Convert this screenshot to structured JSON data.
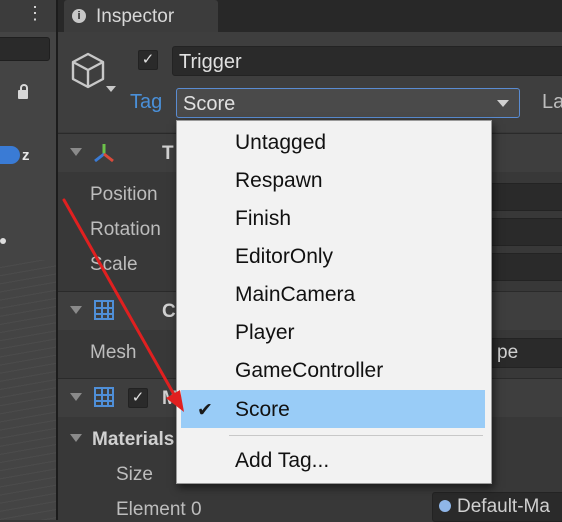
{
  "scene": {
    "axis_label": "z"
  },
  "inspector": {
    "tab_label": "Inspector",
    "object": {
      "name": "Trigger",
      "active_checked": true
    },
    "tag_label": "Tag",
    "tag_value": "Score",
    "layer_label": "La",
    "transform": {
      "title": "T",
      "rows": [
        "Position",
        "Rotation",
        "Scale"
      ]
    },
    "mesh_filter": {
      "title": "C",
      "mesh_label": "Mesh",
      "mesh_value_partial": "pe"
    },
    "mesh_renderer": {
      "title": "M",
      "materials_label": "Materials",
      "size_label": "Size",
      "element0_label": "Element 0",
      "element0_value": "Default-Ma"
    }
  },
  "tag_dropdown": {
    "items": [
      {
        "label": "Untagged",
        "selected": false
      },
      {
        "label": "Respawn",
        "selected": false
      },
      {
        "label": "Finish",
        "selected": false
      },
      {
        "label": "EditorOnly",
        "selected": false
      },
      {
        "label": "MainCamera",
        "selected": false
      },
      {
        "label": "Player",
        "selected": false
      },
      {
        "label": "GameController",
        "selected": false
      },
      {
        "label": "Score",
        "selected": true
      }
    ],
    "add_tag_label": "Add Tag...",
    "check_glyph": "✔"
  },
  "colors": {
    "accent_blue": "#4a90d9",
    "selection": "#99ccf7",
    "annotation_arrow": "#e02020"
  }
}
